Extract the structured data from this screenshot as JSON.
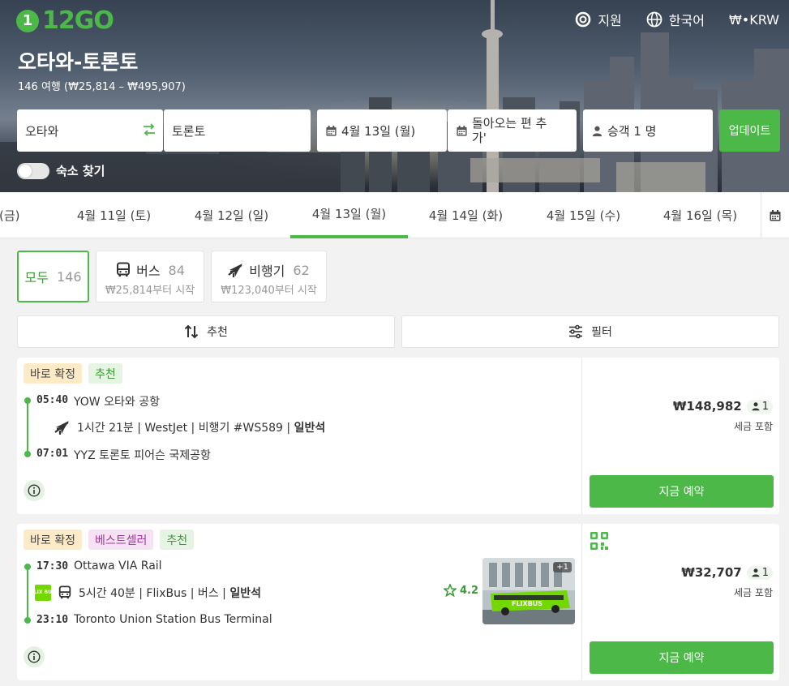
{
  "brand": {
    "logo_mark": "1",
    "logo_text": "12GO",
    "accent": "#4cb848"
  },
  "header": {
    "nav": [
      {
        "label": "지원",
        "icon": "lifebuoy-icon"
      },
      {
        "label": "한국어",
        "icon": "globe-icon"
      },
      {
        "label": "₩•KRW",
        "icon": ""
      }
    ],
    "title": "오타와-토론토",
    "subtitle": "146 여행 (₩25,814 – ₩495,907)"
  },
  "search": {
    "from": "오타와",
    "to": "토론토",
    "depart_date": "4월 13일 (월)",
    "return_date": "돌아오는 편 추가'",
    "passengers": "승객 1 명",
    "update_label": "업데이트",
    "accommodation_label": "숙소 찾기"
  },
  "dates": [
    {
      "label": "일 (금)",
      "active": false
    },
    {
      "label": "4월 11일 (토)",
      "active": false
    },
    {
      "label": "4월 12일 (일)",
      "active": false
    },
    {
      "label": "4월 13일 (월)",
      "active": true
    },
    {
      "label": "4월 14일 (화)",
      "active": false
    },
    {
      "label": "4월 15일 (수)",
      "active": false
    },
    {
      "label": "4월 16일 (목)",
      "active": false
    }
  ],
  "modes": {
    "all": {
      "label": "모두",
      "count": "146"
    },
    "bus": {
      "label": "버스",
      "count": "84",
      "price": "₩25,814부터 시작",
      "icon": "bus-icon"
    },
    "plane": {
      "label": "비행기",
      "count": "62",
      "price": "₩123,040부터 시작",
      "icon": "plane-icon"
    }
  },
  "sort": {
    "recommend_label": "추천",
    "filter_label": "필터"
  },
  "results": [
    {
      "badges": [
        "바로 확정",
        "추천"
      ],
      "depart_time": "05:40",
      "depart_place": "YOW 오타와 공항",
      "detail": "1시간 21분 | WestJet | 비행기 #WS589 | ",
      "class": "일반석",
      "arrive_time": "07:01",
      "arrive_place": "YYZ 토론토 피어슨 국제공항",
      "price": "₩148,982",
      "pax": "1",
      "tax": "세금 포함",
      "book": "지금 예약"
    },
    {
      "badges": [
        "바로 확정",
        "베스트셀러",
        "추천"
      ],
      "depart_time": "17:30",
      "depart_place": "Ottawa VIA Rail",
      "detail": "5시간 40분 | FlixBus | 버스 | ",
      "class": "일반석",
      "arrive_time": "23:10",
      "arrive_place": "Toronto Union Station Bus Terminal",
      "operator_logo": "FLIX BUS",
      "rating": "4.2",
      "photo_count": "+1",
      "photo_text": "FLIXBUS",
      "price": "₩32,707",
      "pax": "1",
      "tax": "세금 포함",
      "book": "지금 예약"
    }
  ]
}
